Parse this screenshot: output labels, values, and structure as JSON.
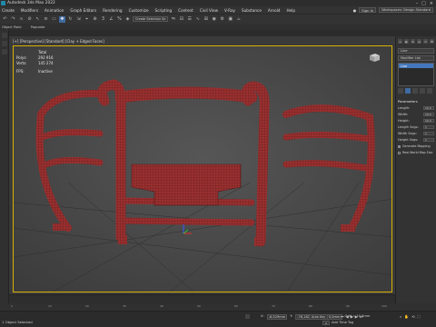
{
  "titlebar": {
    "title": "Autodesk 3ds Max 2022"
  },
  "menu": {
    "items": [
      "Create",
      "Modifiers",
      "Animation",
      "Graph Editors",
      "Rendering",
      "Customize",
      "Scripting",
      "Content",
      "Civil View",
      "V-Ray",
      "Substance",
      "Arnold",
      "Help"
    ],
    "signin": "Sign In",
    "workspace": "Workspaces: Design Standard"
  },
  "toolbar": {
    "selection_set": "Create Selection Se"
  },
  "ribbon": {
    "tabs": [
      "Object Paint",
      "Populate"
    ]
  },
  "viewport": {
    "label": "[+] [Perspective] [Standard] [Clay + Edged Faces]",
    "stats": {
      "total_label": "Total",
      "polys_label": "Polys:",
      "polys_value": "292 916",
      "verts_label": "Verts:",
      "verts_value": "145 274",
      "fps_label": "FPS:",
      "fps_value": "Inactive"
    }
  },
  "command_panel": {
    "object_name": "Line",
    "modifier_list": "Modifier List",
    "stack_item": "Line",
    "rollout_title": "Parameters",
    "params": [
      {
        "label": "Length:",
        "value": "10.0"
      },
      {
        "label": "Width:",
        "value": "10.0"
      },
      {
        "label": "Height:",
        "value": "10.0"
      },
      {
        "label": "Length Segs:",
        "value": "1"
      },
      {
        "label": "Width Segs:",
        "value": "1"
      },
      {
        "label": "Height Segs:",
        "value": "1"
      }
    ],
    "checks": [
      {
        "label": "Generate Mapping",
        "on": true
      },
      {
        "label": "Real-World Map Size",
        "on": false
      }
    ]
  },
  "trackbar": {
    "ticks": [
      "0",
      "10",
      "20",
      "30",
      "40",
      "50",
      "60",
      "70",
      "80",
      "90",
      "100"
    ]
  },
  "statusbar": {
    "selection": "1 Object Selected",
    "x_label": "X:",
    "x_value": "-6,529mm",
    "y_label": "Y:",
    "y_value": "-78,182mm",
    "z_label": "Z:",
    "z_value": "0,0mm",
    "grid": "Grid = 10,0mm",
    "autokey": "Auto Key",
    "frame": "0",
    "add_time_tag": "Add Time Tag"
  },
  "colors": {
    "accent": "#3f6aa0",
    "viewport_border": "#d9b200",
    "model": "#8c2d2d"
  }
}
